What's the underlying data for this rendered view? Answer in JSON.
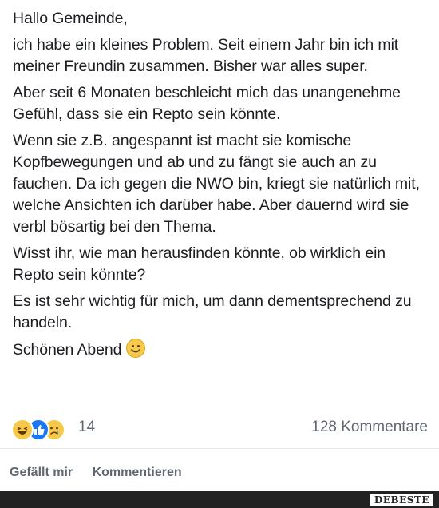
{
  "post": {
    "greeting": "Hallo Gemeinde,",
    "paragraphs": [
      "ich habe ein kleines Problem. Seit einem Jahr bin ich mit meiner Freundin zusammen. Bisher war alles super.",
      "Aber seit 6 Monaten beschleicht mich das unangenehme Gefühl, dass sie ein Repto sein könnte.",
      "Wenn sie z.B. angespannt ist macht sie komische Kopfbewegungen und ab und zu fängt sie auch an zu fauchen. Da ich gegen die NWO bin, kriegt sie natürlich mit, welche Ansichten ich darüber habe. Aber dauernd wird sie verbl bösartig bei den Thema.",
      "Wisst ihr, wie man herausfinden könnte, ob wirklich ein Repto sein könnte?",
      "Es ist sehr wichtig für mich, um dann dementsprechend zu handeln."
    ],
    "closing": "Schönen Abend"
  },
  "reactions": {
    "icons": [
      "haha-icon",
      "like-icon",
      "sad-icon"
    ],
    "count": "14",
    "comments": "128 Kommentare"
  },
  "actions": {
    "like_label": "Gefällt mir",
    "comment_label": "Kommentieren"
  },
  "watermark": "DEBESTE",
  "colors": {
    "text": "#1c1e21",
    "muted": "#606770",
    "like_blue": "#1877f2",
    "emoji_yellow": "#f7c948",
    "bottom_bar": "#222222"
  }
}
